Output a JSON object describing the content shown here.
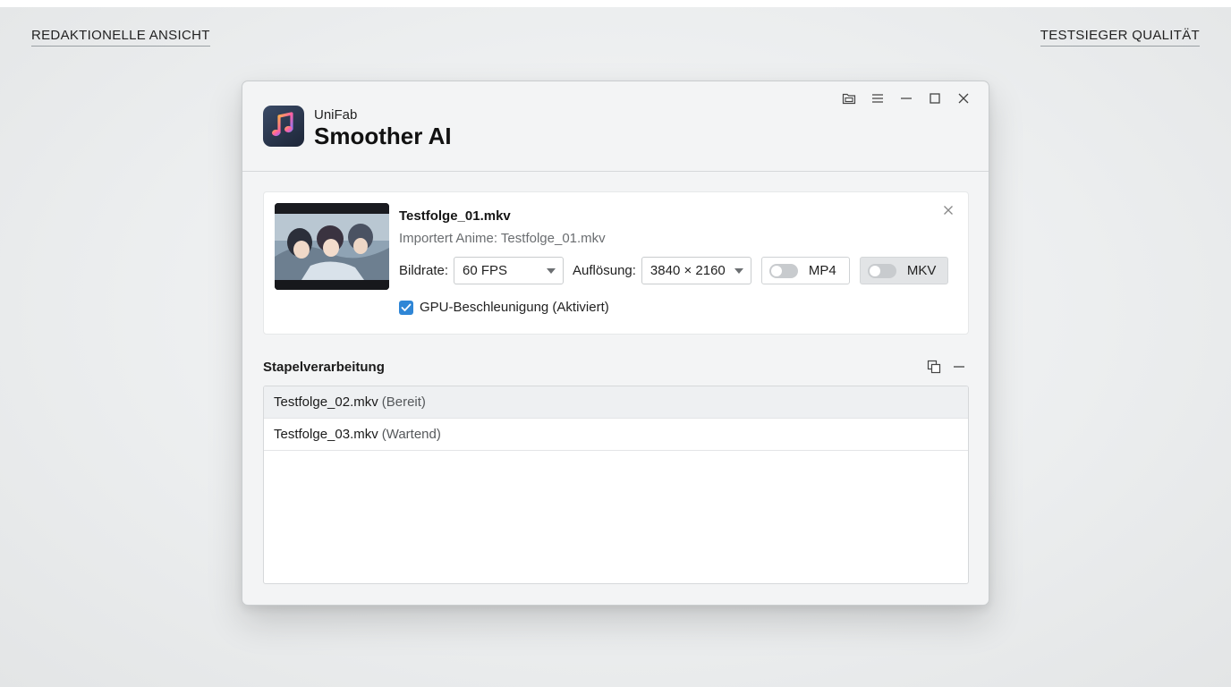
{
  "page": {
    "corner_left": "REDAKTIONELLE ANSICHT",
    "corner_right": "TESTSIEGER QUALITÄT"
  },
  "app": {
    "brand": "UniFab",
    "name": "Smoother AI",
    "icon": "music-note-app-icon",
    "window_controls": [
      "open-folder-icon",
      "menu-icon",
      "minimize-icon",
      "maximize-icon",
      "close-icon"
    ]
  },
  "current_file": {
    "title": "Testfolge_01.mkv",
    "subtitle": "Importert Anime: Testfolge_01.mkv",
    "framerate_label": "Bildrate:",
    "framerate_value": "60 FPS",
    "resolution_label": "Auflösung:",
    "resolution_value": "3840 × 2160",
    "formats": [
      {
        "label": "MP4",
        "enabled": false
      },
      {
        "label": "MKV",
        "enabled": false
      }
    ],
    "gpu_label": "GPU-Beschleunigung (Aktiviert)",
    "gpu_checked": true
  },
  "batch": {
    "title": "Stapelverarbeitung",
    "items": [
      {
        "name": "Testfolge_02.mkv",
        "status": "(Bereit)"
      },
      {
        "name": "Testfolge_03.mkv",
        "status": "(Wartend)"
      }
    ]
  },
  "colors": {
    "accent": "#2f86d6",
    "window_bg": "#f3f4f5",
    "app_icon_bg": "#1d2638"
  }
}
